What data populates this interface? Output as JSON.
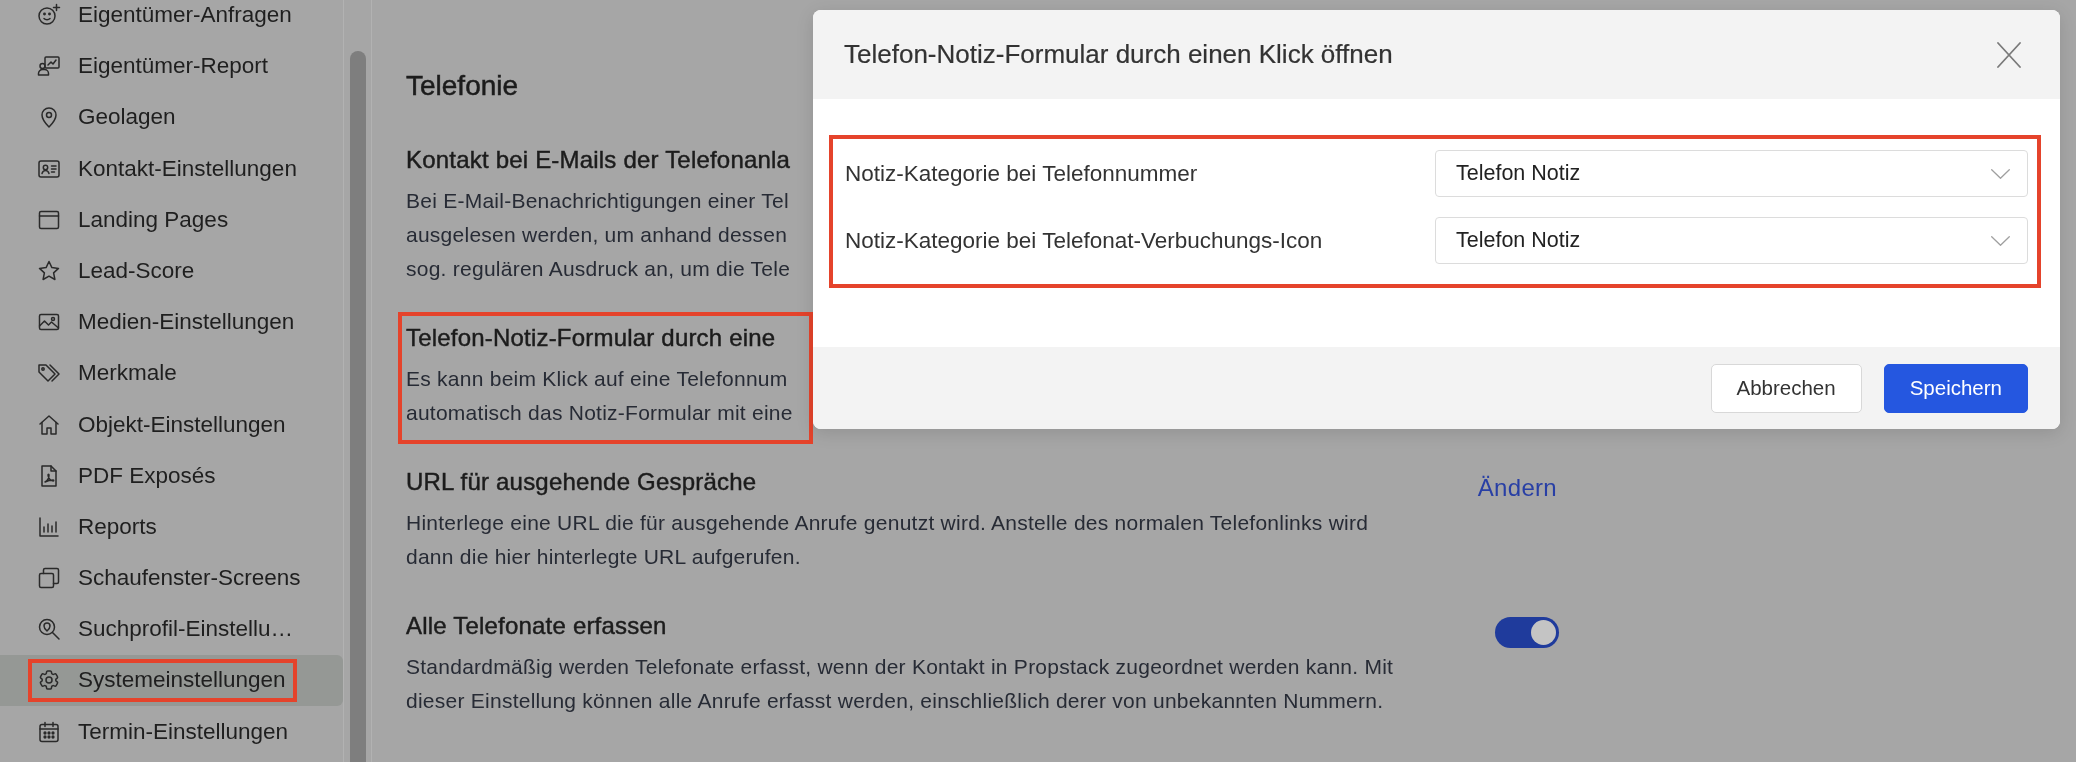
{
  "sidebar": {
    "items": [
      {
        "label": "Eigentümer-Anfragen",
        "selected": false,
        "highlighted": false
      },
      {
        "label": "Eigentümer-Report",
        "selected": false,
        "highlighted": false
      },
      {
        "label": "Geolagen",
        "selected": false,
        "highlighted": false
      },
      {
        "label": "Kontakt-Einstellungen",
        "selected": false,
        "highlighted": false
      },
      {
        "label": "Landing Pages",
        "selected": false,
        "highlighted": false
      },
      {
        "label": "Lead-Score",
        "selected": false,
        "highlighted": false
      },
      {
        "label": "Medien-Einstellungen",
        "selected": false,
        "highlighted": false
      },
      {
        "label": "Merkmale",
        "selected": false,
        "highlighted": false
      },
      {
        "label": "Objekt-Einstellungen",
        "selected": false,
        "highlighted": false
      },
      {
        "label": "PDF Exposés",
        "selected": false,
        "highlighted": false
      },
      {
        "label": "Reports",
        "selected": false,
        "highlighted": false
      },
      {
        "label": "Schaufenster-Screens",
        "selected": false,
        "highlighted": false
      },
      {
        "label": "Suchprofil-Einstellu…",
        "selected": false,
        "highlighted": false
      },
      {
        "label": "Systemeinstellungen",
        "selected": true,
        "highlighted": true
      },
      {
        "label": "Termin-Einstellungen",
        "selected": false,
        "highlighted": false
      }
    ]
  },
  "main": {
    "title": "Telefonie",
    "sections": [
      {
        "kind": "plain",
        "title": "Kontakt bei E-Mails der Telefonanla",
        "description_lines": [
          "Bei E-Mail-Benachrichtigungen einer Tel",
          "ausgelesen werden, um anhand dessen",
          "sog. regulären Ausdruck an, um die Tele"
        ],
        "highlighted": false
      },
      {
        "kind": "plain",
        "title": "Telefon-Notiz-Formular durch eine",
        "description_lines": [
          "Es kann beim Klick auf eine Telefonnum",
          "automatisch das Notiz-Formular mit eine"
        ],
        "highlighted": true
      },
      {
        "kind": "link",
        "title": "URL für ausgehende Gespräche",
        "description_lines": [
          "Hinterlege eine URL die für ausgehende Anrufe genutzt wird. Anstelle des normalen Telefonlinks wird",
          "dann die hier hinterlegte URL aufgerufen."
        ],
        "link": "Ändern",
        "highlighted": false
      },
      {
        "kind": "toggle",
        "title": "Alle Telefonate erfassen",
        "description_lines": [
          "Standardmäßig werden Telefonate erfasst, wenn der Kontakt in Propstack zugeordnet werden kann. Mit",
          "dieser Einstellung können alle Anrufe erfasst werden, einschließlich derer von unbekannten Nummern."
        ],
        "on": true,
        "highlighted": false
      }
    ]
  },
  "dialog": {
    "title": "Telefon-Notiz-Formular durch einen Klick öffnen",
    "form": {
      "highlighted": true,
      "fields": [
        {
          "label": "Notiz-Kategorie bei Telefonnummer",
          "value": "Telefon Notiz"
        },
        {
          "label": "Notiz-Kategorie bei Telefonat-Verbuchungs-Icon",
          "value": "Telefon Notiz"
        }
      ]
    },
    "buttons": [
      {
        "label": "Abbrechen",
        "kind": "secondary"
      },
      {
        "label": "Speichern",
        "kind": "primary"
      }
    ]
  }
}
